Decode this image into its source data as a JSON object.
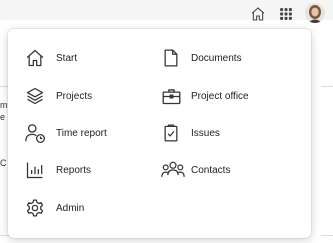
{
  "menu": {
    "left_column": [
      {
        "label": "Start",
        "icon": "home-icon"
      },
      {
        "label": "Projects",
        "icon": "layers-icon"
      },
      {
        "label": "Time report",
        "icon": "user-clock-icon"
      },
      {
        "label": "Reports",
        "icon": "bar-chart-icon"
      },
      {
        "label": "Admin",
        "icon": "gear-icon"
      }
    ],
    "right_column": [
      {
        "label": "Documents",
        "icon": "document-icon"
      },
      {
        "label": "Project office",
        "icon": "briefcase-icon"
      },
      {
        "label": "Issues",
        "icon": "clipboard-check-icon"
      },
      {
        "label": "Contacts",
        "icon": "people-icon"
      }
    ]
  },
  "background": {
    "frag1": "m",
    "frag2": "e",
    "frag3": "C"
  }
}
